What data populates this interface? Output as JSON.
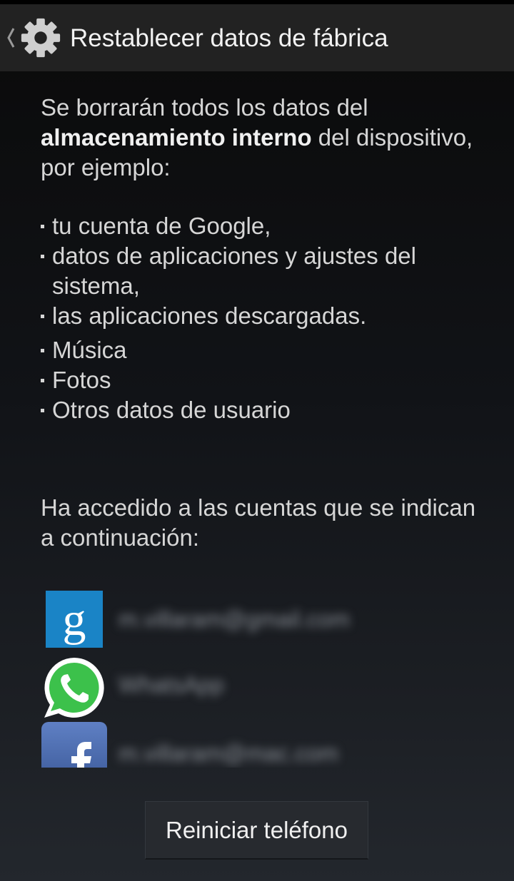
{
  "action_bar": {
    "title": "Restablecer datos de fábrica",
    "up_icon": "chevron-left-icon",
    "app_icon": "gear-icon"
  },
  "intro": {
    "text_before": "Se borrarán todos los datos del ",
    "text_bold": "almacenamiento interno",
    "text_after": " del dispositivo, por ejemplo:"
  },
  "bullets": [
    "tu cuenta de Google,",
    "datos de aplicaciones y ajustes del sistema,",
    "las aplicaciones descargadas.",
    "Música",
    "Fotos",
    "Otros datos de usuario"
  ],
  "accounts_intro": "Ha accedido a las cuentas que se indican a continuación:",
  "accounts": [
    {
      "icon": "google-icon",
      "label": "m.villaram@gmail.com"
    },
    {
      "icon": "whatsapp-icon",
      "label": "WhatsApp"
    },
    {
      "icon": "facebook-icon",
      "label": "m.villaram@mac.com"
    }
  ],
  "reset_button": {
    "label": "Reiniciar teléfono"
  },
  "colors": {
    "action_bar": "#222222",
    "google_blue": "#1a84c6",
    "whatsapp_green": "#3cc14b",
    "facebook_blue": "#3b5998"
  }
}
